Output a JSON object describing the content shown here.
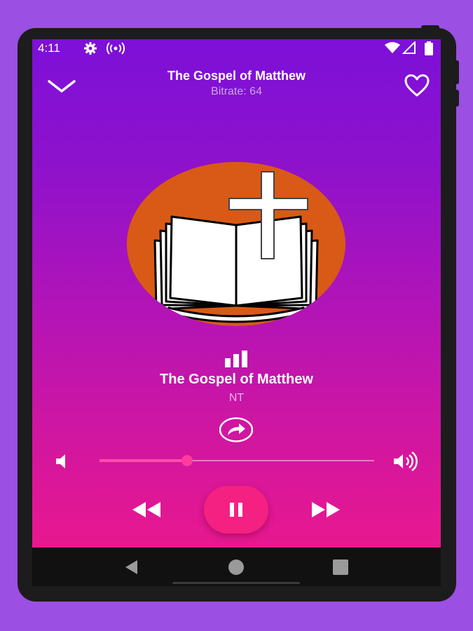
{
  "status_bar": {
    "time": "4:11",
    "icons": [
      "settings-icon",
      "broadcast-icon",
      "wifi-icon",
      "signal-icon",
      "battery-icon"
    ]
  },
  "header": {
    "title": "The Gospel of Matthew",
    "subtitle": "Bitrate: 64",
    "left_icon": "chevron-down-icon",
    "right_icon": "heart-outline-icon"
  },
  "artwork": {
    "icon": "bible-cross-icon",
    "circle_color": "#d95a16"
  },
  "now_playing": {
    "status_icon": "equalizer-icon",
    "title": "The Gospel of Matthew",
    "subtitle": "NT",
    "share_icon": "share-icon"
  },
  "volume": {
    "low_icon": "volume-low-icon",
    "high_icon": "volume-high-icon",
    "level": 0.32
  },
  "controls": {
    "rewind_icon": "rewind-icon",
    "play_pause_icon": "pause-icon",
    "forward_icon": "fast-forward-icon",
    "accent": "#f42182"
  },
  "system_nav": {
    "back_icon": "nav-back-icon",
    "home_icon": "nav-home-icon",
    "recents_icon": "nav-recents-icon"
  },
  "colors": {
    "background": "#9b4fe3",
    "gradient_top": "#7d10d8",
    "gradient_bottom": "#e8188f"
  }
}
